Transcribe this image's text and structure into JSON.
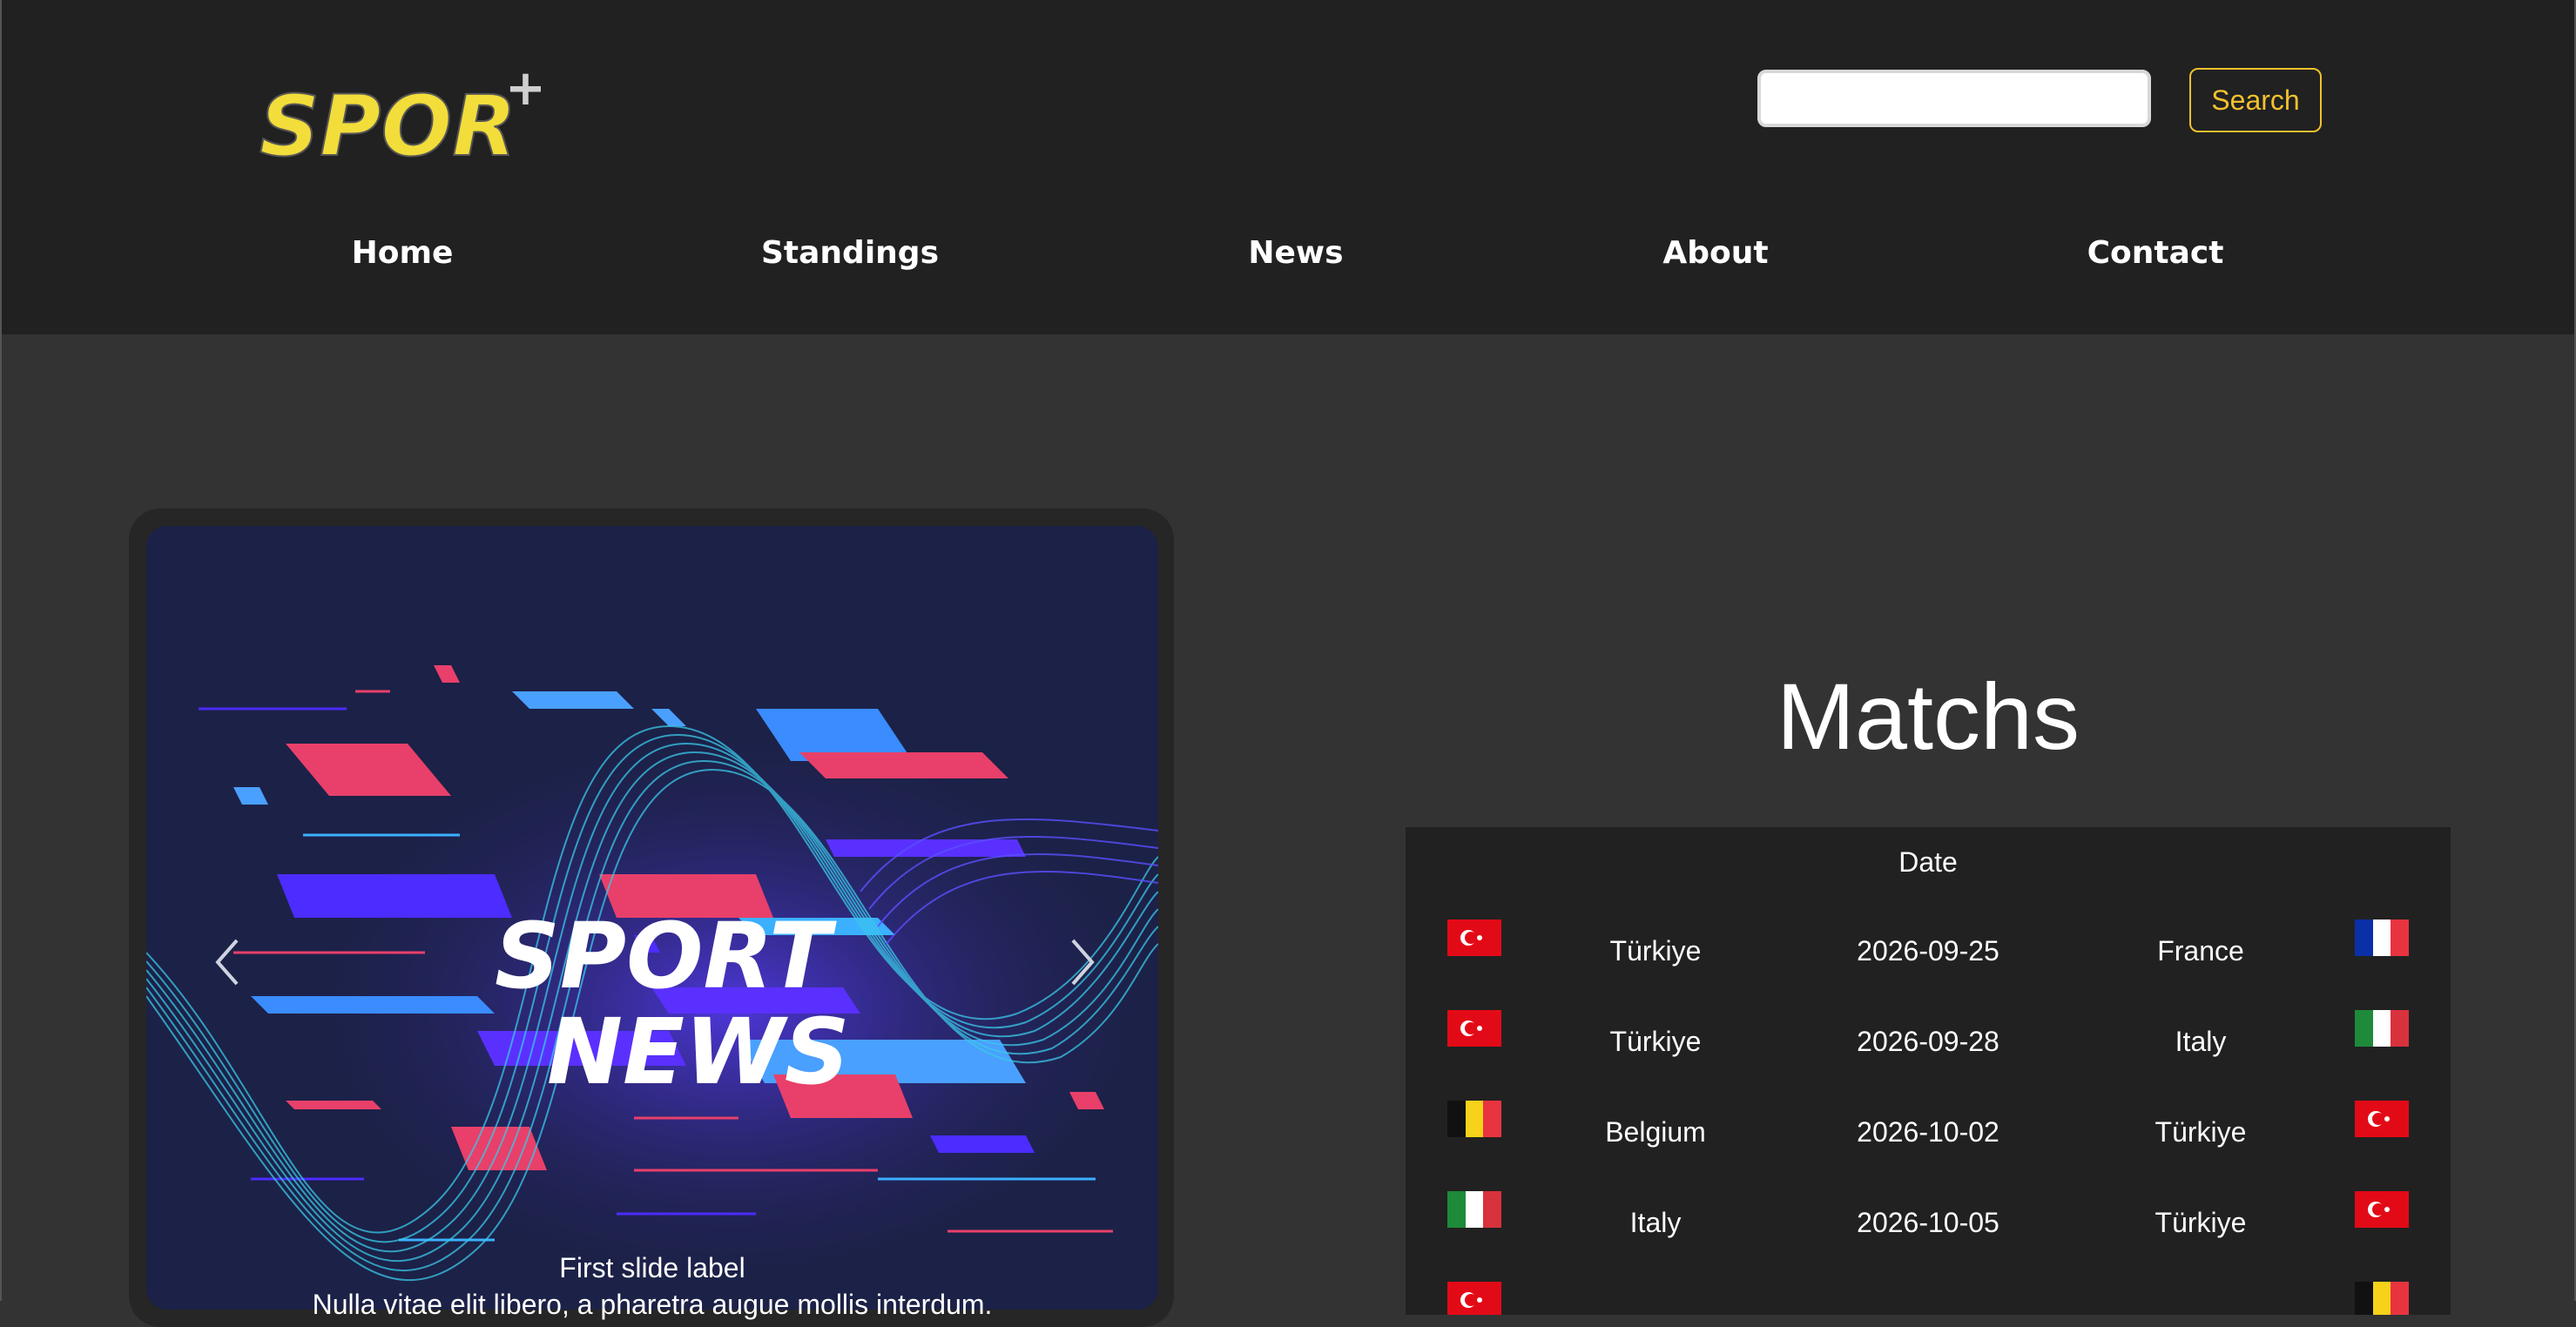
{
  "brand": {
    "logo_text": "SPOR",
    "logo_plus": "+"
  },
  "search": {
    "placeholder": "",
    "value": "",
    "button_label": "Search"
  },
  "nav": {
    "items": [
      {
        "label": "Home"
      },
      {
        "label": "Standings"
      },
      {
        "label": "News"
      },
      {
        "label": "About"
      },
      {
        "label": "Contact"
      }
    ]
  },
  "carousel": {
    "slide_image": {
      "line1": "SPORT",
      "line2": "NEWS"
    },
    "caption_label": "First slide label",
    "caption_text": "Nulla vitae elit libero, a pharetra augue mollis interdum."
  },
  "matches": {
    "title": "Matchs",
    "date_header": "Date",
    "rows": [
      {
        "home": "Türkiye",
        "date": "2026-09-25",
        "away": "France",
        "home_flag": "turkey-flag",
        "away_flag": "france-flag"
      },
      {
        "home": "Türkiye",
        "date": "2026-09-28",
        "away": "Italy",
        "home_flag": "turkey-flag",
        "away_flag": "italy-flag"
      },
      {
        "home": "Belgium",
        "date": "2026-10-02",
        "away": "Türkiye",
        "home_flag": "belgium-flag",
        "away_flag": "turkey-flag"
      },
      {
        "home": "Italy",
        "date": "2026-10-05",
        "away": "Türkiye",
        "home_flag": "italy-flag",
        "away_flag": "turkey-flag"
      },
      {
        "home": "",
        "date": "",
        "away": "",
        "home_flag": "turkey-flag",
        "away_flag": "belgium-flag"
      }
    ]
  },
  "colors": {
    "header_bg": "#212121",
    "page_bg": "#333333",
    "accent": "#f2c12e",
    "slide_bg": "#1c2147"
  }
}
